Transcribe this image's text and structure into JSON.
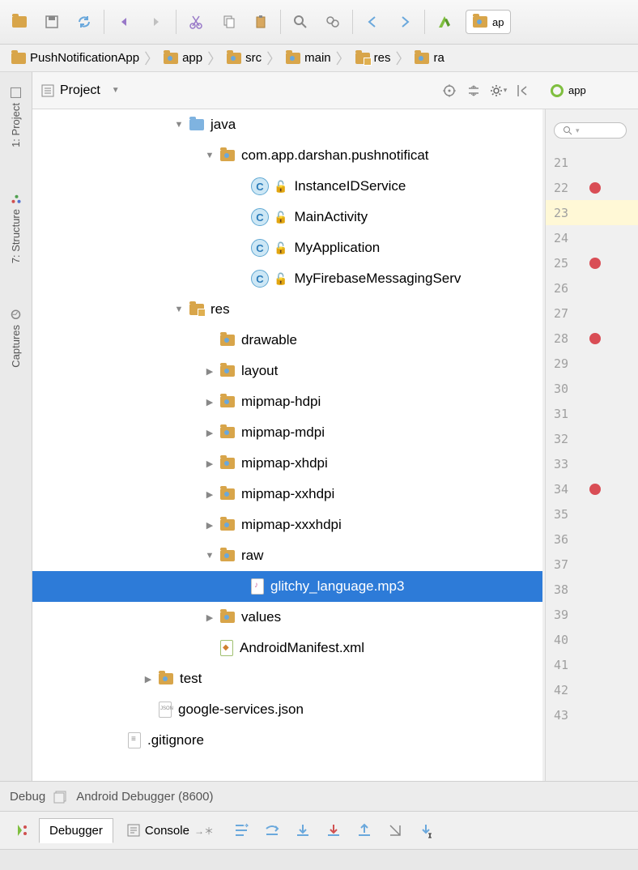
{
  "toolbar": {
    "app_selector_label": "ap"
  },
  "breadcrumb": {
    "items": [
      {
        "label": "PushNotificationApp",
        "icon": "folder"
      },
      {
        "label": "app",
        "icon": "folder-dot"
      },
      {
        "label": "src",
        "icon": "folder-dot"
      },
      {
        "label": "main",
        "icon": "folder-dot"
      },
      {
        "label": "res",
        "icon": "folder-res"
      },
      {
        "label": "ra",
        "icon": "folder-dot"
      }
    ]
  },
  "left_tabs": {
    "project": "1: Project",
    "structure": "7: Structure",
    "captures": "Captures"
  },
  "panel": {
    "title": "Project"
  },
  "tree": [
    {
      "indent": 3,
      "arrow": "down",
      "icon": "folder-blue",
      "label": "java"
    },
    {
      "indent": 4,
      "arrow": "down",
      "icon": "folder-dot",
      "label": "com.app.darshan.pushnotificat"
    },
    {
      "indent": 5,
      "arrow": "",
      "icon": "class",
      "label": "InstanceIDService"
    },
    {
      "indent": 5,
      "arrow": "",
      "icon": "class",
      "label": "MainActivity"
    },
    {
      "indent": 5,
      "arrow": "",
      "icon": "class",
      "label": "MyApplication"
    },
    {
      "indent": 5,
      "arrow": "",
      "icon": "class",
      "label": "MyFirebaseMessagingServ"
    },
    {
      "indent": 3,
      "arrow": "down",
      "icon": "folder-res",
      "label": "res"
    },
    {
      "indent": 4,
      "arrow": "",
      "icon": "folder-dot",
      "label": "drawable"
    },
    {
      "indent": 4,
      "arrow": "right",
      "icon": "folder-dot",
      "label": "layout"
    },
    {
      "indent": 4,
      "arrow": "right",
      "icon": "folder-dot",
      "label": "mipmap-hdpi"
    },
    {
      "indent": 4,
      "arrow": "right",
      "icon": "folder-dot",
      "label": "mipmap-mdpi"
    },
    {
      "indent": 4,
      "arrow": "right",
      "icon": "folder-dot",
      "label": "mipmap-xhdpi"
    },
    {
      "indent": 4,
      "arrow": "right",
      "icon": "folder-dot",
      "label": "mipmap-xxhdpi"
    },
    {
      "indent": 4,
      "arrow": "right",
      "icon": "folder-dot",
      "label": "mipmap-xxxhdpi"
    },
    {
      "indent": 4,
      "arrow": "down",
      "icon": "folder-dot",
      "label": "raw"
    },
    {
      "indent": 5,
      "arrow": "",
      "icon": "mp3",
      "label": "glitchy_language.mp3",
      "selected": true
    },
    {
      "indent": 4,
      "arrow": "right",
      "icon": "folder-dot",
      "label": "values"
    },
    {
      "indent": 4,
      "arrow": "",
      "icon": "xml",
      "label": "AndroidManifest.xml"
    },
    {
      "indent": 2,
      "arrow": "right",
      "icon": "folder-dot",
      "label": "test"
    },
    {
      "indent": 2,
      "arrow": "",
      "icon": "json",
      "label": "google-services.json"
    },
    {
      "indent": 1,
      "arrow": "",
      "icon": "txt",
      "label": ".gitignore"
    }
  ],
  "gutter": {
    "app_label": "app",
    "search_placeholder": "",
    "lines": [
      {
        "n": 21,
        "bp": false
      },
      {
        "n": 22,
        "bp": true
      },
      {
        "n": 23,
        "bp": false,
        "hl": true
      },
      {
        "n": 24,
        "bp": false
      },
      {
        "n": 25,
        "bp": true
      },
      {
        "n": 26,
        "bp": false
      },
      {
        "n": 27,
        "bp": false
      },
      {
        "n": 28,
        "bp": true
      },
      {
        "n": 29,
        "bp": false
      },
      {
        "n": 30,
        "bp": false
      },
      {
        "n": 31,
        "bp": false
      },
      {
        "n": 32,
        "bp": false
      },
      {
        "n": 33,
        "bp": false
      },
      {
        "n": 34,
        "bp": true
      },
      {
        "n": 35,
        "bp": false
      },
      {
        "n": 36,
        "bp": false
      },
      {
        "n": 37,
        "bp": false
      },
      {
        "n": 38,
        "bp": false
      },
      {
        "n": 39,
        "bp": false
      },
      {
        "n": 40,
        "bp": false
      },
      {
        "n": 41,
        "bp": false
      },
      {
        "n": 42,
        "bp": false
      },
      {
        "n": 43,
        "bp": false
      }
    ]
  },
  "debug": {
    "status_label": "Debug",
    "status_text": "Android Debugger (8600)",
    "debugger_tab": "Debugger",
    "console_tab": "Console"
  }
}
